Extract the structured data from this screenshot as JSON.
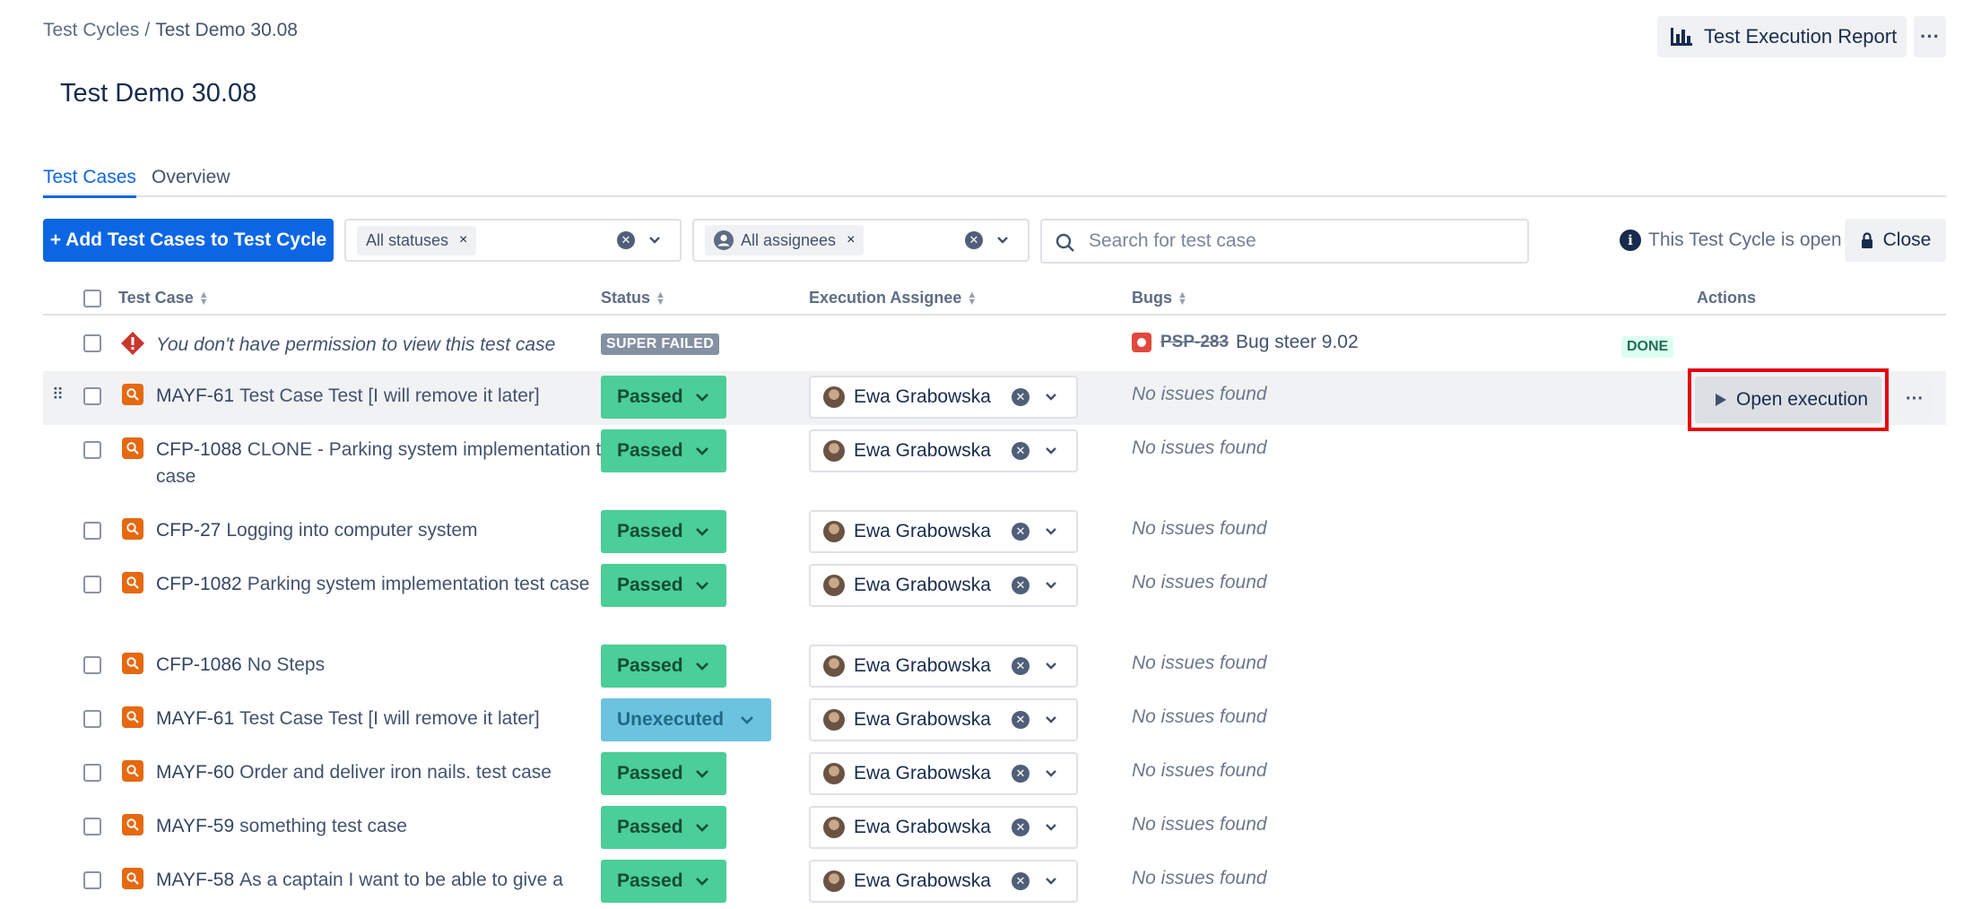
{
  "breadcrumb": {
    "parent": "Test Cycles",
    "separator": "/",
    "current": "Test Demo 30.08"
  },
  "page_title": "Test Demo 30.08",
  "header": {
    "report_button": "Test Execution Report",
    "more_button": "···"
  },
  "tabs": [
    {
      "label": "Test Cases",
      "active": true
    },
    {
      "label": "Overview",
      "active": false
    }
  ],
  "toolbar": {
    "add_button": "+ Add Test Cases to Test Cycle",
    "status_filter": {
      "chip": "All statuses",
      "chip_remove": "×"
    },
    "assignee_filter": {
      "chip": "All assignees",
      "chip_remove": "×"
    },
    "search": {
      "placeholder": "Search for test case",
      "value": ""
    },
    "open_note": "This Test Cycle is open",
    "close_button": "Close"
  },
  "table": {
    "columns": {
      "test_case": "Test Case",
      "status": "Status",
      "assignee": "Execution Assignee",
      "bugs": "Bugs",
      "actions": "Actions"
    },
    "permission_row": {
      "text": "You don't have permission to view this test case",
      "status": "SUPER FAILED",
      "bug_key": "PSP-283",
      "bug_title": "Bug steer 9.02",
      "bug_status": "DONE"
    },
    "rows": [
      {
        "key": "MAYF-61",
        "title": "Test Case Test [I will remove it later]",
        "status": "Passed",
        "assignee": "Ewa Grabowska",
        "bugs": "No issues found"
      },
      {
        "key": "CFP-1088",
        "title": "CLONE - Parking system implementation test case",
        "status": "Passed",
        "assignee": "Ewa Grabowska",
        "bugs": "No issues found"
      },
      {
        "key": "CFP-27",
        "title": "Logging into computer system",
        "status": "Passed",
        "assignee": "Ewa Grabowska",
        "bugs": "No issues found"
      },
      {
        "key": "CFP-1082",
        "title": "Parking system implementation test case",
        "status": "Passed",
        "assignee": "Ewa Grabowska",
        "bugs": "No issues found"
      },
      {
        "key": "CFP-1086",
        "title": "No Steps",
        "status": "Passed",
        "assignee": "Ewa Grabowska",
        "bugs": "No issues found"
      },
      {
        "key": "MAYF-61",
        "title": "Test Case Test [I will remove it later]",
        "status": "Unexecuted",
        "assignee": "Ewa Grabowska",
        "bugs": "No issues found"
      },
      {
        "key": "MAYF-60",
        "title": "Order and deliver iron nails. test case",
        "status": "Passed",
        "assignee": "Ewa Grabowska",
        "bugs": "No issues found"
      },
      {
        "key": "MAYF-59",
        "title": "something test case",
        "status": "Passed",
        "assignee": "Ewa Grabowska",
        "bugs": "No issues found"
      },
      {
        "key": "MAYF-58",
        "title": "As a captain I want to be able to give a",
        "status": "Passed",
        "assignee": "Ewa Grabowska",
        "bugs": "No issues found"
      }
    ],
    "row_action": {
      "open_execution": "Open execution",
      "more": "···"
    }
  },
  "colors": {
    "primary": "#0c66e4",
    "passed": "#4bce97",
    "unexecuted": "#6cc3e0",
    "super_failed": "#8590a2",
    "highlight": "#e3000f"
  }
}
